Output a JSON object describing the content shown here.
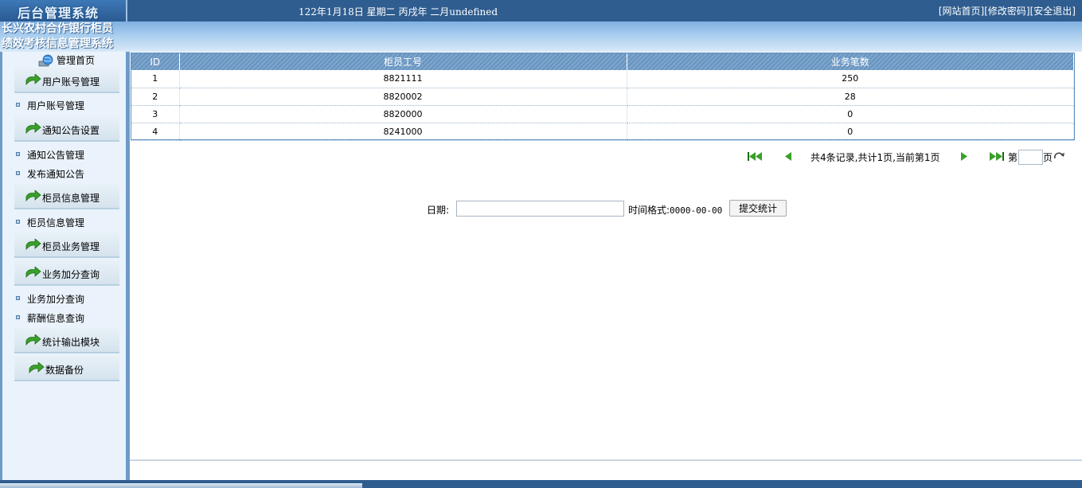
{
  "header": {
    "logo_text": "后台管理系统",
    "date_text": "122年1月18日 星期二 丙戌年 二月undefined",
    "links": [
      "[网站首页]",
      "[修改密码]",
      "[安全退出]"
    ]
  },
  "system_title_line1": "长兴农村合作银行柜员",
  "system_title_line2": "绩效考核信息管理系统",
  "sidebar": {
    "home_label": "管理首页",
    "modules": [
      {
        "label": "用户账号管理"
      },
      {
        "label": "通知公告设置"
      },
      {
        "label": "柜员信息管理"
      },
      {
        "label": "柜员业务管理"
      },
      {
        "label": "业务加分查询"
      },
      {
        "label": "统计输出模块"
      },
      {
        "label": "数据备份"
      }
    ],
    "subitems": [
      {
        "label": "用户账号管理"
      },
      {
        "label": "通知公告管理"
      },
      {
        "label": "发布通知公告"
      },
      {
        "label": "柜员信息管理"
      },
      {
        "label": "业务加分查询"
      },
      {
        "label": "薪酬信息查询"
      }
    ]
  },
  "table": {
    "columns": [
      "ID",
      "柜员工号",
      "业务笔数"
    ],
    "rows": [
      [
        "1",
        "8821111",
        "250"
      ],
      [
        "2",
        "8820002",
        "28"
      ],
      [
        "3",
        "8820000",
        "0"
      ],
      [
        "4",
        "8241000",
        "0"
      ]
    ]
  },
  "pager": {
    "summary": "共4条记录,共计1页,当前第1页",
    "page_prefix": "第",
    "page_suffix": "页"
  },
  "form": {
    "date_label": "日期:",
    "format_label": "时间格式:",
    "format_value": "0000-00-00",
    "submit_label": "提交统计"
  },
  "colors": {
    "header_bar": "#2f5d8f",
    "table_header": "#7ea6cd",
    "sidebar_bg": "#eaf3fb",
    "icon_green": "#3aa02a"
  }
}
